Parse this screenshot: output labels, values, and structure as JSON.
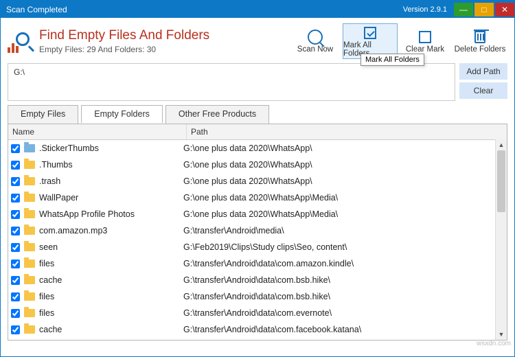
{
  "window": {
    "title": "Scan Completed",
    "version": "Version 2.9.1"
  },
  "header": {
    "app_title": "Find Empty Files And Folders",
    "summary": "Empty Files: 29 And Folders: 30",
    "scan_now": "Scan Now",
    "mark_all": "Mark All Folders",
    "clear_mark": "Clear Mark",
    "delete_folders": "Delete Folders",
    "tooltip": "Mark All Folders"
  },
  "path_area": {
    "value": "G:\\",
    "add_path": "Add Path",
    "clear": "Clear"
  },
  "tabs": {
    "empty_files": "Empty Files",
    "empty_folders": "Empty Folders",
    "other": "Other Free Products"
  },
  "grid": {
    "col_name": "Name",
    "col_path": "Path",
    "rows": [
      {
        "name": ".StickerThumbs",
        "path": "G:\\one plus data 2020\\WhatsApp\\",
        "blue": true
      },
      {
        "name": ".Thumbs",
        "path": "G:\\one plus data 2020\\WhatsApp\\"
      },
      {
        "name": ".trash",
        "path": "G:\\one plus data 2020\\WhatsApp\\"
      },
      {
        "name": "WallPaper",
        "path": "G:\\one plus data 2020\\WhatsApp\\Media\\"
      },
      {
        "name": "WhatsApp Profile Photos",
        "path": "G:\\one plus data 2020\\WhatsApp\\Media\\"
      },
      {
        "name": "com.amazon.mp3",
        "path": "G:\\transfer\\Android\\media\\"
      },
      {
        "name": "seen",
        "path": "G:\\Feb2019\\Clips\\Study clips\\Seo, content\\"
      },
      {
        "name": "files",
        "path": "G:\\transfer\\Android\\data\\com.amazon.kindle\\"
      },
      {
        "name": "cache",
        "path": "G:\\transfer\\Android\\data\\com.bsb.hike\\"
      },
      {
        "name": "files",
        "path": "G:\\transfer\\Android\\data\\com.bsb.hike\\"
      },
      {
        "name": "files",
        "path": "G:\\transfer\\Android\\data\\com.evernote\\"
      },
      {
        "name": "cache",
        "path": "G:\\transfer\\Android\\data\\com.facebook.katana\\"
      }
    ]
  },
  "watermark": "wsxdn.com"
}
